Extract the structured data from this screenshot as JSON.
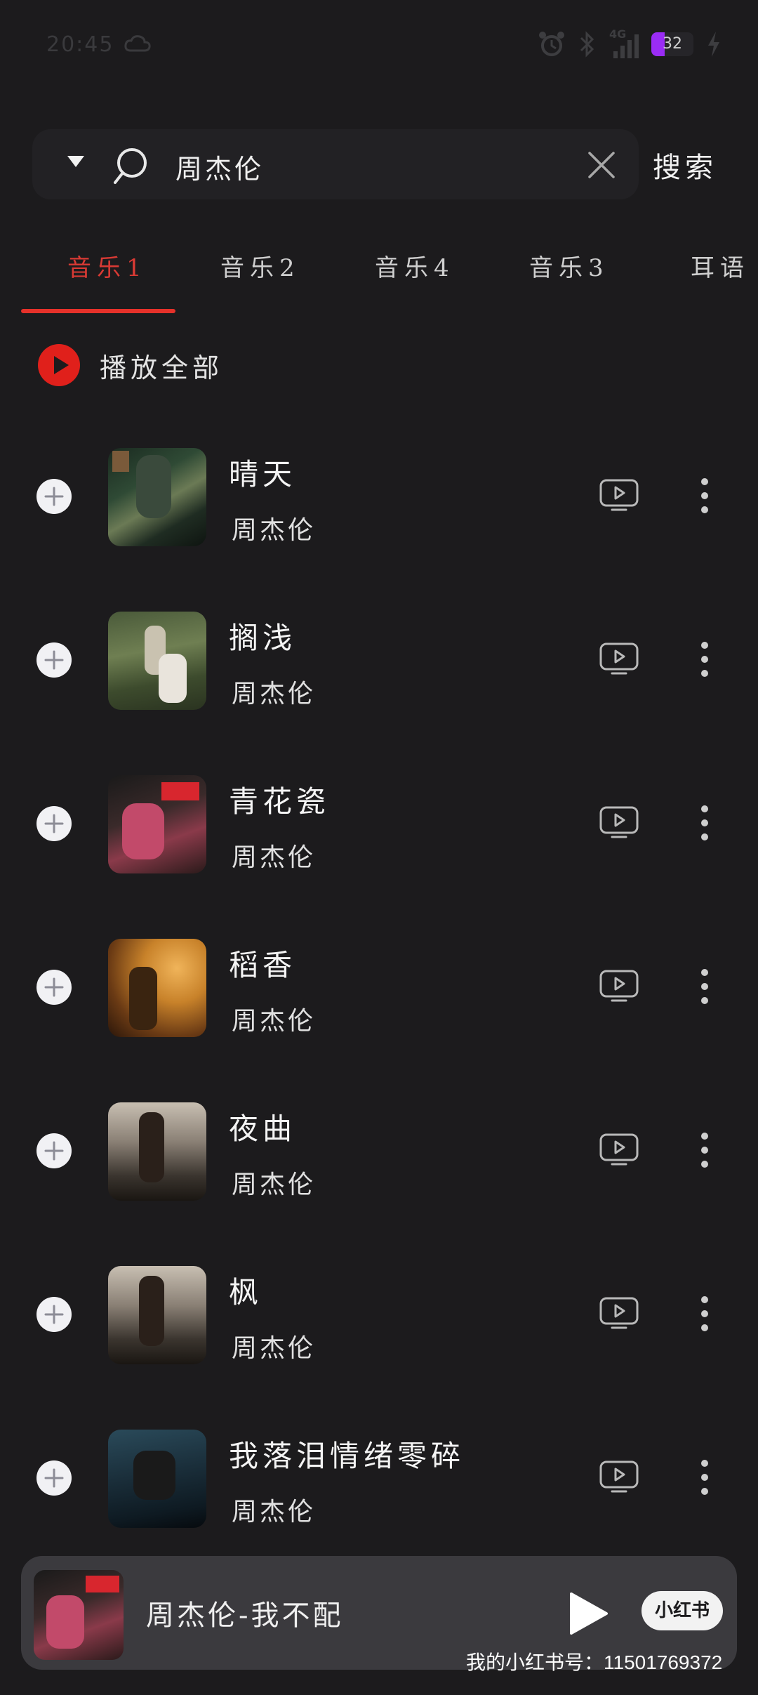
{
  "status_bar": {
    "time": "20:45",
    "network": "4G",
    "battery": "32",
    "battery_level": 0.32,
    "battery_color": "#9a2cf5"
  },
  "search": {
    "query": "周杰伦",
    "button_label": "搜索"
  },
  "tabs": [
    {
      "label": "音乐1",
      "active": true
    },
    {
      "label": "音乐2",
      "active": false
    },
    {
      "label": "音乐4",
      "active": false
    },
    {
      "label": "音乐3",
      "active": false
    },
    {
      "label": "耳语",
      "active": false
    }
  ],
  "accent_color": "#e5312a",
  "play_all": {
    "label": "播放全部"
  },
  "songs": [
    {
      "title": "晴天",
      "artist": "周杰伦"
    },
    {
      "title": "搁浅",
      "artist": "周杰伦"
    },
    {
      "title": "青花瓷",
      "artist": "周杰伦"
    },
    {
      "title": "稻香",
      "artist": "周杰伦"
    },
    {
      "title": "夜曲",
      "artist": "周杰伦"
    },
    {
      "title": "枫",
      "artist": "周杰伦"
    },
    {
      "title": "我落泪情绪零碎",
      "artist": "周杰伦"
    }
  ],
  "now_playing": {
    "title": "周杰伦-我不配",
    "badge": "小红书"
  },
  "watermark": "我的小红书号：11501769372"
}
